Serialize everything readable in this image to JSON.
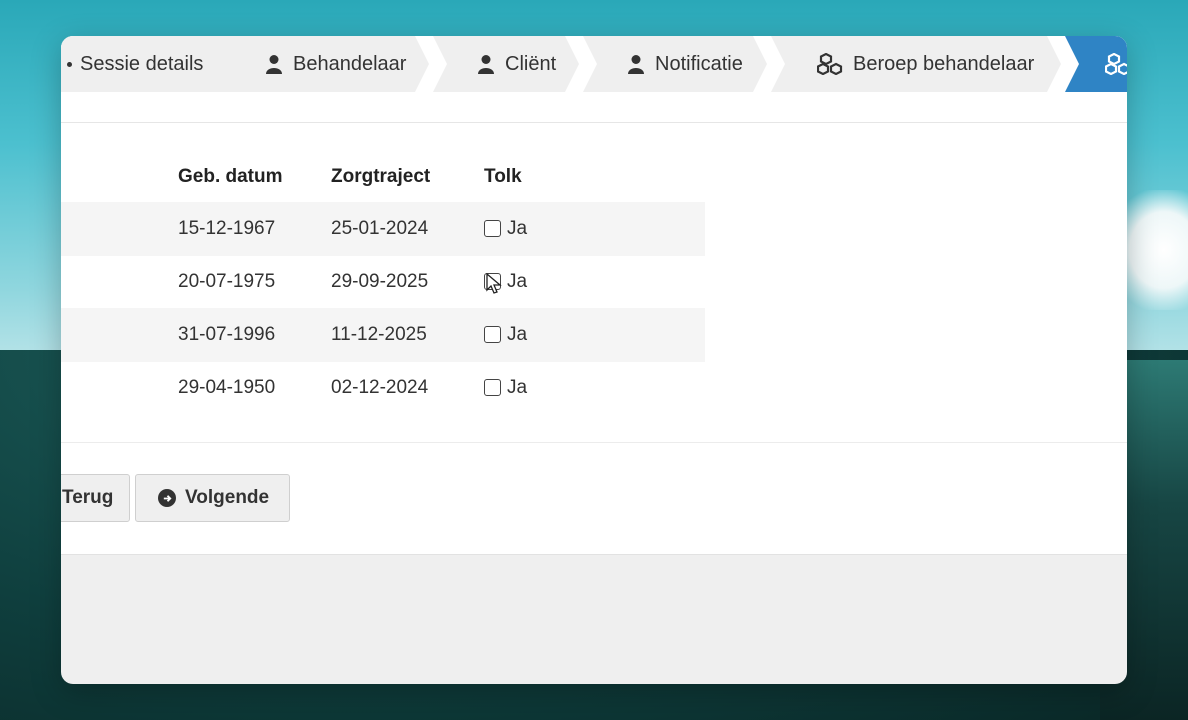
{
  "wizard": {
    "steps": [
      {
        "label": "Sessie details",
        "icon": "dot-icon"
      },
      {
        "label": "Behandelaar",
        "icon": "user-icon"
      },
      {
        "label": "Cliënt",
        "icon": "user-icon"
      },
      {
        "label": "Notificatie",
        "icon": "user-icon"
      },
      {
        "label": "Beroep behandelaar",
        "icon": "cubes-icon"
      },
      {
        "label": "",
        "icon": "cubes-icon",
        "active": true
      }
    ]
  },
  "table": {
    "headers": {
      "birthdate": "Geb. datum",
      "care_track": "Zorgtraject",
      "interpreter": "Tolk"
    },
    "rows": [
      {
        "birthdate": "15-12-1967",
        "care_track": "25-01-2024",
        "interpreter_label": "Ja",
        "checked": false
      },
      {
        "birthdate": "20-07-1975",
        "care_track": "29-09-2025",
        "interpreter_label": "Ja",
        "checked": false
      },
      {
        "birthdate": "31-07-1996",
        "care_track": "11-12-2025",
        "interpreter_label": "Ja",
        "checked": false
      },
      {
        "birthdate": "29-04-1950",
        "care_track": "02-12-2024",
        "interpreter_label": "Ja",
        "checked": false
      }
    ]
  },
  "actions": {
    "back_label": "Terug",
    "next_label": "Volgende"
  },
  "colors": {
    "active_step": "#2f84c5",
    "step_bg": "#efefef"
  }
}
